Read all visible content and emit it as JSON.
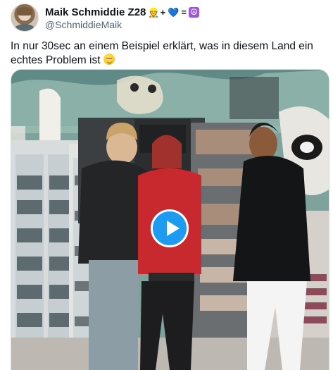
{
  "author": {
    "display_name": "Maik Schmiddie Z28",
    "name_emojis": [
      "👷",
      "+",
      "💙",
      "=",
      "☮"
    ],
    "handle": "@SchmiddieMaik"
  },
  "tweet": {
    "text": "In nur 30sec an einem Beispiel erklärt, was in diesem Land ein echtes Problem ist"
  },
  "media": {
    "type": "video",
    "play_icon": "play-icon"
  },
  "colors": {
    "accent": "#1d9bf0",
    "text": "#0f1419",
    "secondary_text": "#536471"
  }
}
